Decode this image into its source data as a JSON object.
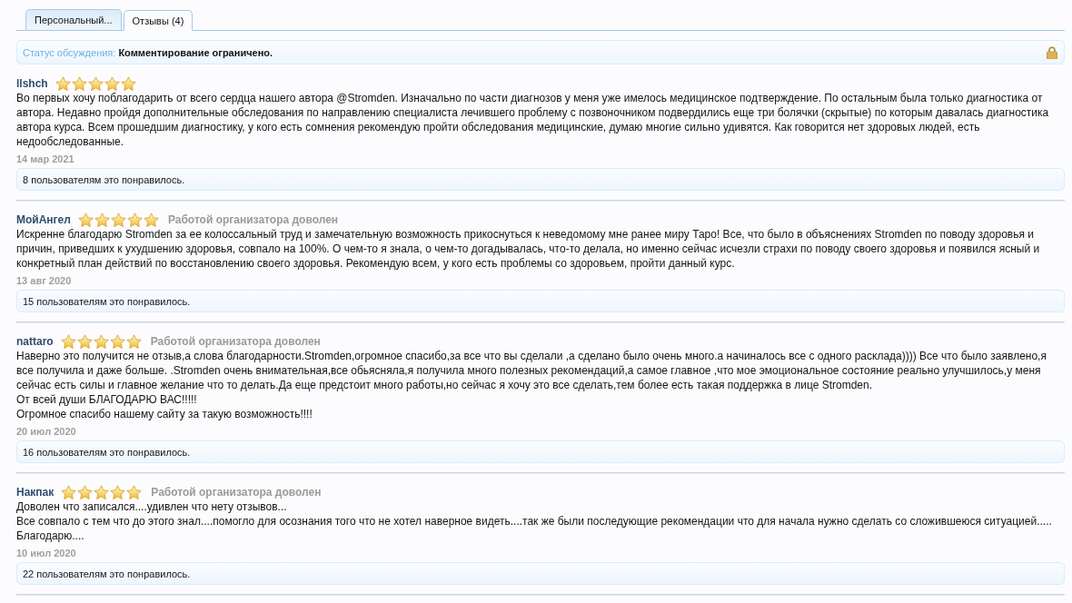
{
  "tabs": [
    {
      "label": "Персональный...",
      "selected": false
    },
    {
      "label": "Отзывы (4)",
      "selected": true
    }
  ],
  "discussion_status": {
    "label": "Статус обсуждения:",
    "value": "Комментирование ограничено.",
    "locked": true
  },
  "reviews": [
    {
      "author": "llshch",
      "stars": 5,
      "paragraphs": [
        "Во первых хочу поблагодарить от всего сердца нашего автора @Stromden. Изначально по части диагнозов у меня уже имелось медицинское подтверждение. По остальным была только диагностика от автора. Недавно пройдя дополнительные обследования по направлению специалиста лечившего проблему с позвоночником подвердились еще три болячки (скрытые) по которым давалась диагностика автора курса. Всем прошедшим диагностику, у кого есть сомнения рекомендую пройти обследования медицинские, думаю многие сильно удивятся. Как говорится нет здоровых людей, есть недообследованные."
      ],
      "date": "14 мар 2021",
      "likes": "8 пользователям это понравилось."
    },
    {
      "author": "МойАнгел",
      "stars": 5,
      "verdict": "Работой организатора доволен",
      "paragraphs": [
        "Искренне благодарю Stromden за ее колоссальный труд и замечательную возможность прикоснуться к неведомому мне ранее миру Таро! Все, что было в объяснениях Stromden по поводу здоровья и причин, приведших к ухудшению здоровья, совпало на 100%. О чем-то я знала, о чем-то догадывалась, что-то делала, но именно сейчас исчезли страхи по поводу своего здоровья и появился ясный и конкретный план действий по восстановлению своего здоровья. Рекомендую всем, у кого есть проблемы со здоровьем, пройти данный курс."
      ],
      "date": "13 авг 2020",
      "likes": "15 пользователям это понравилось."
    },
    {
      "author": "nattaro",
      "stars": 5,
      "verdict": "Работой организатора доволен",
      "paragraphs": [
        "Наверно это получится не отзыв,а слова благодарности.Stromden,огромное спасибо,за все что вы сделали ,а сделано было очень много.а начиналось все с одного расклада)))) Все что было заявлено,я все получила и даже больше. .Stromden очень внимательная,все обьясняла,я получила много полезных рекомендаций,а самое главное ,что мое эмоциональное состояние реально улучшилось,у меня сейчас есть силы и главное желание что то делать.Да еще предстоит много работы,но сейчас я хочу это все сделать,тем более есть такая поддержка в лице Stromden.",
        "От всей души БЛАГОДАРЮ ВАС!!!!!",
        "Огромное спасибо нашему сайту за такую возможность!!!!"
      ],
      "date": "20 июл 2020",
      "likes": "16 пользователям это понравилось."
    },
    {
      "author": "Накпак",
      "stars": 5,
      "verdict": "Работой организатора доволен",
      "paragraphs": [
        "Доволен что записался....удивлен что нету отзывов...",
        "Все совпало с тем что до этого знал....помогло для осознания того что не хотел наверное видеть....так же были последующие рекомендации что для начала нужно сделать со сложившеюся ситуацией.....",
        "Благодарю...."
      ],
      "date": "10 июл 2020",
      "likes": "22 пользователям это понравилось."
    }
  ]
}
